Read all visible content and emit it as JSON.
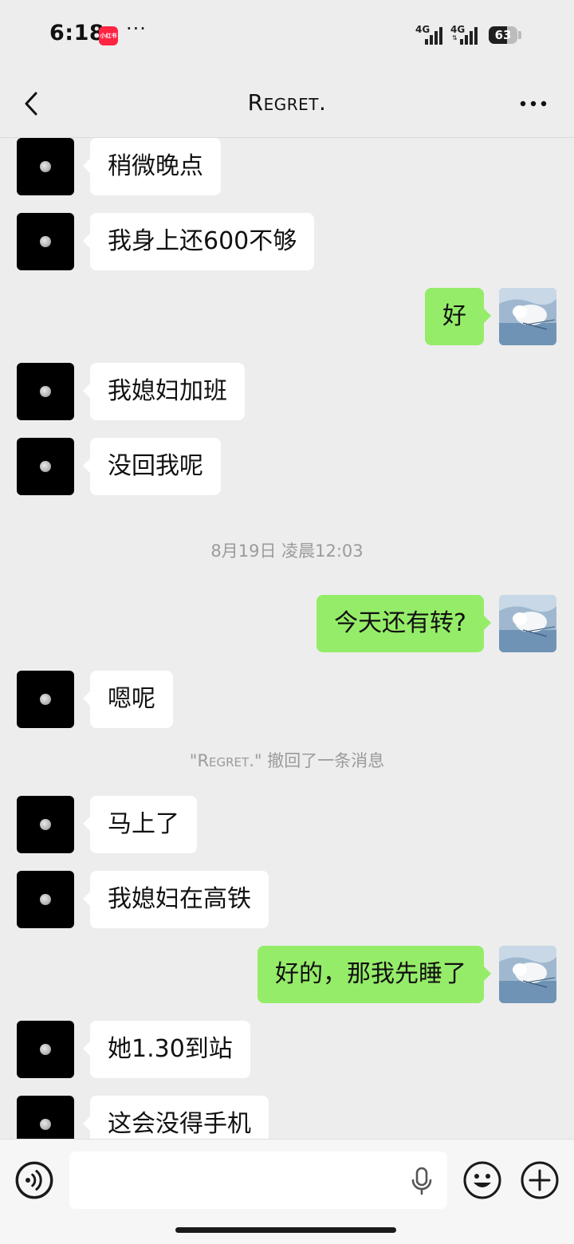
{
  "status_bar": {
    "time": "6:18",
    "app_badge": "小红书",
    "dots": "···",
    "network_1": "4G",
    "network_2": "4G",
    "battery": "63",
    "battery_level": 0.63
  },
  "header": {
    "title": "Regret.",
    "back_icon": "chevron-left-icon",
    "more_icon": "more-horizontal-icon"
  },
  "messages": [
    {
      "side": "in",
      "text": "稍微晚点"
    },
    {
      "side": "in",
      "text": "我身上还600不够"
    },
    {
      "side": "out",
      "text": "好"
    },
    {
      "side": "in",
      "text": "我媳妇加班"
    },
    {
      "side": "in",
      "text": "没回我呢"
    },
    {
      "side": "system",
      "text": "8月19日 凌晨12:03"
    },
    {
      "side": "out",
      "text": "今天还有转?"
    },
    {
      "side": "in",
      "text": "嗯呢"
    },
    {
      "side": "system",
      "name": "\"Regret.\"",
      "text": " 撤回了一条消息"
    },
    {
      "side": "in",
      "text": "马上了"
    },
    {
      "side": "in",
      "text": "我媳妇在高铁"
    },
    {
      "side": "out",
      "text": "好的，那我先睡了"
    },
    {
      "side": "in",
      "text": "她1.30到站"
    },
    {
      "side": "in",
      "text": "这会没得手机"
    }
  ],
  "input_bar": {
    "voice_icon": "voice-icon",
    "placeholder": "",
    "mic_icon": "mic-icon",
    "emoji_icon": "emoji-icon",
    "plus_icon": "plus-icon"
  },
  "colors": {
    "background": "#ededed",
    "incoming_bubble": "#ffffff",
    "outgoing_bubble": "#95ec69",
    "system_text": "#9b9b9b",
    "contact_avatar": "#000000"
  }
}
